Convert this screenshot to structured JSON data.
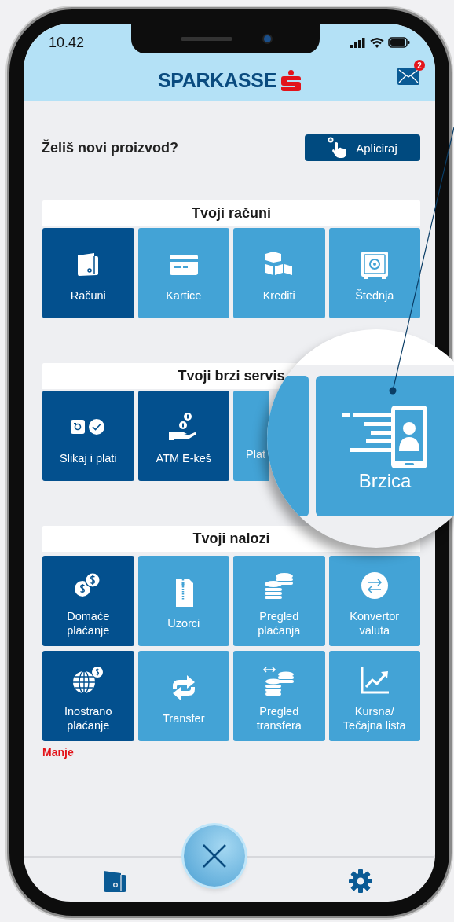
{
  "status_bar": {
    "time": "10.42"
  },
  "header": {
    "logo": "SPARKASSE",
    "mail_badge": "2"
  },
  "promo": {
    "question": "Želiš novi proizvod?",
    "button": "Apliciraj"
  },
  "sections": [
    {
      "title": "Tvoji računi",
      "tiles": [
        {
          "label": "Računi",
          "kind": "featured"
        },
        {
          "label": "Kartice",
          "kind": "regular"
        },
        {
          "label": "Krediti",
          "kind": "regular"
        },
        {
          "label": "Štednja",
          "kind": "regular"
        }
      ]
    },
    {
      "title": "Tvoji brzi servis",
      "tiles": [
        {
          "label": "Slikaj i plati",
          "kind": "featured"
        },
        {
          "label": "ATM E-keš",
          "kind": "featured"
        },
        {
          "label": "Plat",
          "kind": "partial"
        }
      ]
    },
    {
      "title": "Tvoji nalozi",
      "tiles": [
        {
          "label": "Domaće plaćanje",
          "kind": "featured"
        },
        {
          "label": "Uzorci",
          "kind": "regular"
        },
        {
          "label": "Pregled plaćanja",
          "kind": "regular"
        },
        {
          "label": "Konvertor valuta",
          "kind": "regular"
        },
        {
          "label": "Inostrano plaćanje",
          "kind": "featured"
        },
        {
          "label": "Transfer",
          "kind": "regular"
        },
        {
          "label": "Pregled transfera",
          "kind": "regular"
        },
        {
          "label": "Kursna/ Tečajna lista",
          "kind": "regular"
        }
      ]
    }
  ],
  "less_link": "Manje",
  "magnifier": {
    "tile": "Brzica"
  }
}
